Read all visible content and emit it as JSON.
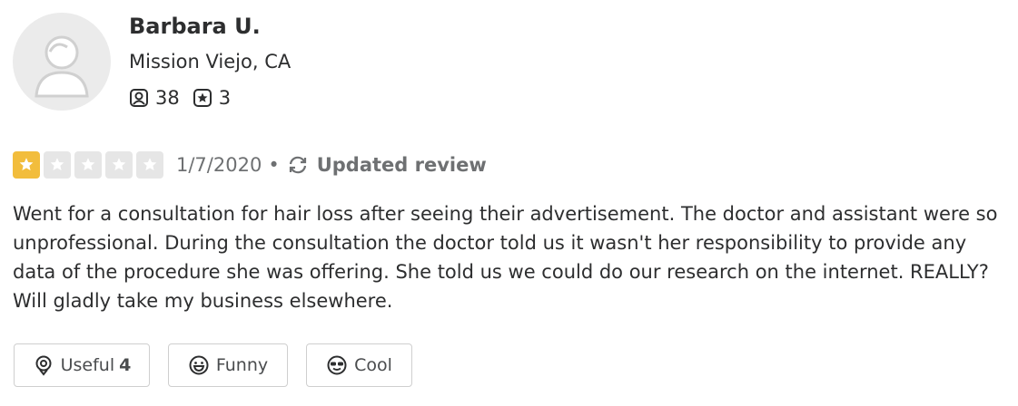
{
  "user": {
    "name": "Barbara U.",
    "location": "Mission Viejo, CA",
    "friends_count": "38",
    "reviews_count": "3"
  },
  "review": {
    "rating": 1,
    "rating_max": 5,
    "date": "1/7/2020",
    "separator": "•",
    "updated_label": "Updated review",
    "text": "Went for a consultation for hair loss after seeing their  advertisement. The doctor and assistant were so unprofessional. During the consultation the doctor told us it wasn't her responsibility to provide any data of the procedure she was offering. She told us we could do our research on the internet. REALLY? Will gladly take my business elsewhere."
  },
  "reactions": {
    "useful_label": "Useful",
    "useful_count": "4",
    "funny_label": "Funny",
    "cool_label": "Cool"
  },
  "colors": {
    "star_filled": "#f2bd3c",
    "star_empty": "#e6e6e6",
    "text": "#2d2e2f",
    "muted": "#6e7072",
    "border": "#cfcfcf"
  },
  "icons": {
    "friends": "friends-icon",
    "reviews": "star-badge-icon",
    "updated": "refresh-icon",
    "useful": "lightbulb-icon",
    "funny": "smiley-icon",
    "cool": "sunglasses-icon"
  }
}
